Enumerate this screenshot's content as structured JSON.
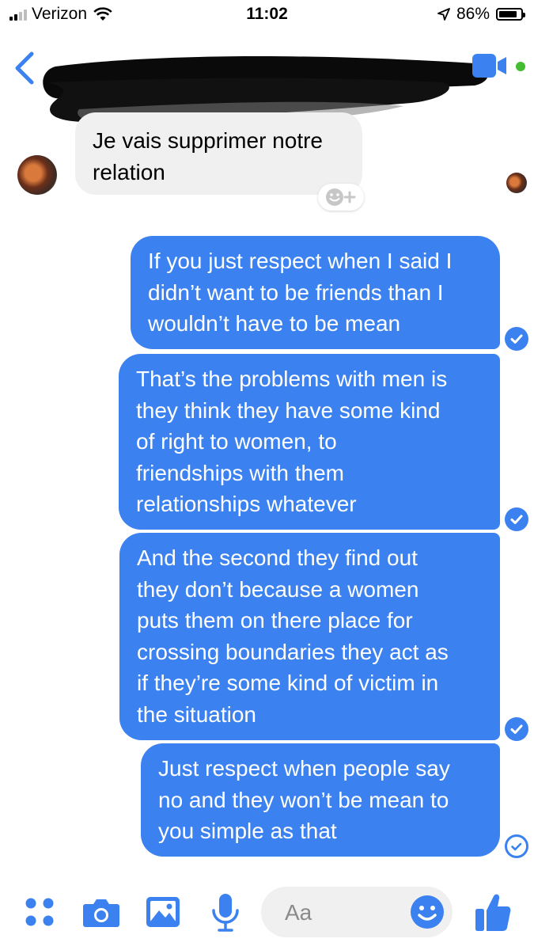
{
  "status_bar": {
    "carrier": "Verizon",
    "time": "11:02",
    "battery_percent": "86%",
    "battery_level": 0.86
  },
  "header": {
    "contact_name_redacted": true,
    "active_status_color": "#44bd32"
  },
  "messages": [
    {
      "direction": "incoming",
      "text": "Je vais supprimer notre\nrelation"
    },
    {
      "direction": "outgoing",
      "text": "If you just respect when I said I\ndidn’t want to be friends than I\nwouldn’t have to be mean",
      "status": "delivered"
    },
    {
      "direction": "outgoing",
      "text": "That’s the problems with men is\nthey think they have some kind\nof right to women, to\nfriendships with them\nrelationships whatever",
      "status": "delivered"
    },
    {
      "direction": "outgoing",
      "text": "And the second they find out\nthey don’t because a women\nputs them on there place for\ncrossing boundaries they act as\nif they’re some kind of victim in\nthe situation",
      "status": "delivered"
    },
    {
      "direction": "outgoing",
      "text": "Just respect when people say\nno and they won’t be mean to\nyou simple as that",
      "status": "sent"
    }
  ],
  "composer": {
    "placeholder": "Aa"
  },
  "colors": {
    "accent": "#3b82f0",
    "incoming_bubble": "#f0f0f0"
  },
  "icons": [
    "back-chevron-icon",
    "video-call-icon",
    "add-reaction-icon",
    "more-apps-icon",
    "camera-icon",
    "gallery-icon",
    "microphone-icon",
    "emoji-icon",
    "thumbs-up-icon"
  ]
}
